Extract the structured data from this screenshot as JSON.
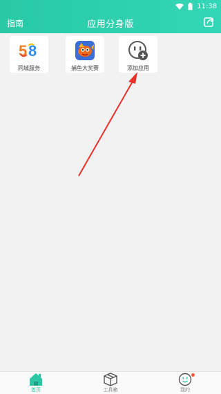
{
  "status_bar": {
    "time": "11:38"
  },
  "header": {
    "left_label": "指南",
    "title": "应用分身版",
    "share_icon": "share-icon"
  },
  "apps": [
    {
      "label": "同城服务",
      "icon": "58-logo-icon"
    },
    {
      "label": "捕鱼大奖赛",
      "icon": "fish-game-icon"
    },
    {
      "label": "添加应用",
      "icon": "add-app-icon"
    }
  ],
  "tabs": [
    {
      "label": "首页",
      "icon": "home-icon",
      "active": true
    },
    {
      "label": "工具箱",
      "icon": "toolbox-icon",
      "active": false
    },
    {
      "label": "我的",
      "icon": "profile-face-icon",
      "active": false,
      "badge": true
    }
  ],
  "colors": {
    "accent": "#2bc7a5",
    "arrow": "#e8312a",
    "badge": "#ff5a3c"
  }
}
